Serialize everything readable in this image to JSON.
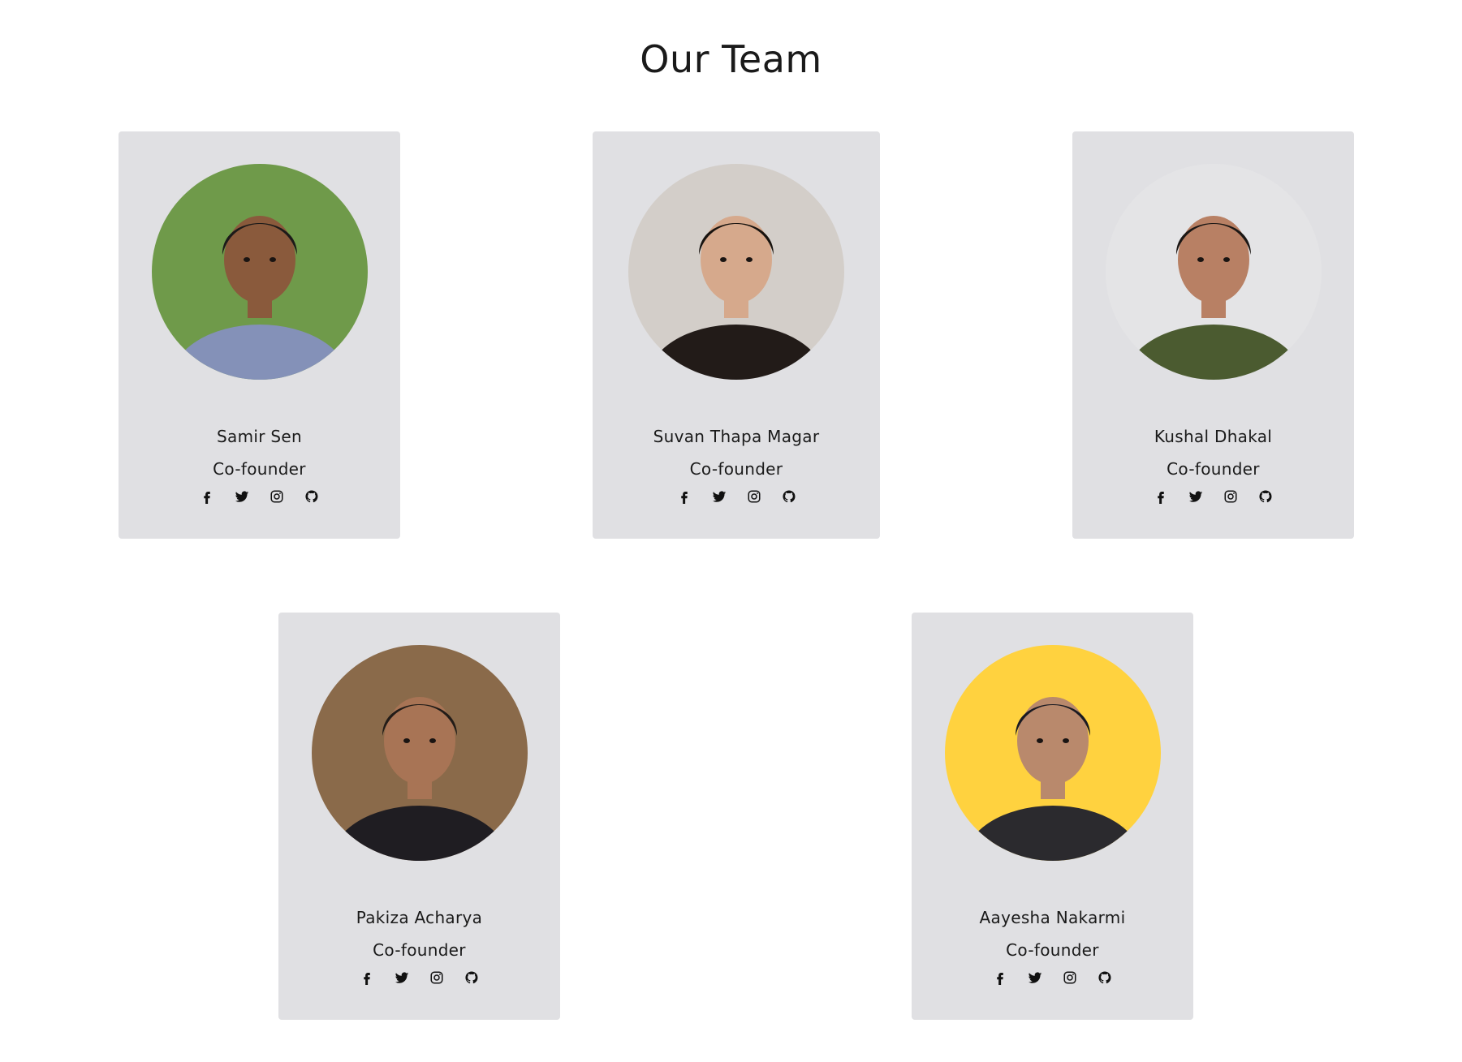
{
  "page": {
    "title": "Our Team"
  },
  "team": [
    {
      "name": "Samir Sen",
      "role": "Co-founder",
      "photo": {
        "bg": "#6f9a4a",
        "skin": "#8a5a3c",
        "hair": "#1c1a19",
        "shirt": "#8491b8"
      }
    },
    {
      "name": "Suvan Thapa Magar",
      "role": "Co-founder",
      "photo": {
        "bg": "#d3cec9",
        "skin": "#d6a98c",
        "hair": "#18130f",
        "shirt": "#221b18"
      }
    },
    {
      "name": "Kushal Dhakal",
      "role": "Co-founder",
      "photo": {
        "bg": "#e4e4e6",
        "skin": "#b88064",
        "hair": "#1b1715",
        "shirt": "#4b5b30"
      }
    },
    {
      "name": "Pakiza Acharya",
      "role": "Co-founder",
      "photo": {
        "bg": "#8a6a4a",
        "skin": "#a87455",
        "hair": "#221c18",
        "shirt": "#1f1d22"
      }
    },
    {
      "name": "Aayesha Nakarmi",
      "role": "Co-founder",
      "photo": {
        "bg": "#ffd23f",
        "skin": "#b9896c",
        "hair": "#1a1a22",
        "shirt": "#2b2a2e"
      }
    }
  ],
  "social_icons": [
    "facebook-icon",
    "twitter-icon",
    "instagram-icon",
    "github-icon"
  ]
}
